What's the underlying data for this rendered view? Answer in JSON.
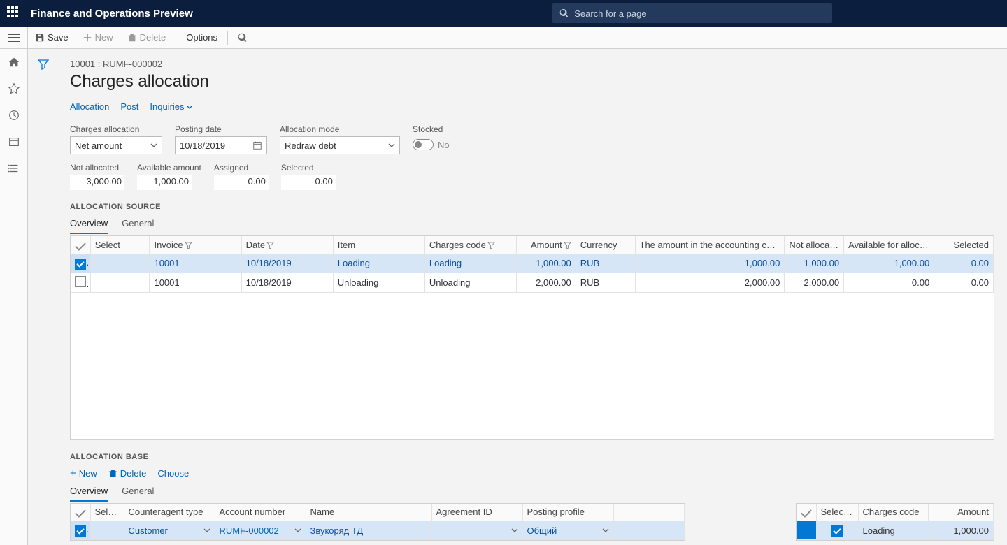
{
  "topbar": {
    "brand": "Finance and Operations Preview",
    "search_placeholder": "Search for a page"
  },
  "toolbar": {
    "save": "Save",
    "new": "New",
    "delete": "Delete",
    "options": "Options"
  },
  "breadcrumb": "10001 : RUMF-000002",
  "page_title": "Charges allocation",
  "actions": {
    "allocation": "Allocation",
    "post": "Post",
    "inquiries": "Inquiries"
  },
  "fields": {
    "charges_allocation": {
      "label": "Charges allocation",
      "value": "Net amount"
    },
    "posting_date": {
      "label": "Posting date",
      "value": "10/18/2019"
    },
    "allocation_mode": {
      "label": "Allocation mode",
      "value": "Redraw debt"
    },
    "stocked": {
      "label": "Stocked",
      "value": "No"
    }
  },
  "stats": {
    "not_allocated": {
      "label": "Not allocated",
      "value": "3,000.00"
    },
    "available": {
      "label": "Available amount",
      "value": "1,000.00"
    },
    "assigned": {
      "label": "Assigned",
      "value": "0.00"
    },
    "selected": {
      "label": "Selected",
      "value": "0.00"
    }
  },
  "section_source": "ALLOCATION SOURCE",
  "tabs_source": {
    "overview": "Overview",
    "general": "General"
  },
  "source_cols": {
    "select": "Select",
    "invoice": "Invoice",
    "date": "Date",
    "item": "Item",
    "charges_code": "Charges code",
    "amount": "Amount",
    "currency": "Currency",
    "acc_amount": "The amount in the accounting currency",
    "not_allocated": "Not allocated",
    "avail": "Available for allocation",
    "selected": "Selected"
  },
  "source_rows": [
    {
      "sel": true,
      "invoice": "10001",
      "date": "10/18/2019",
      "item": "Loading",
      "code": "Loading",
      "amount": "1,000.00",
      "currency": "RUB",
      "acc": "1,000.00",
      "na": "1,000.00",
      "avail": "1,000.00",
      "selv": "0.00"
    },
    {
      "sel": false,
      "invoice": "10001",
      "date": "10/18/2019",
      "item": "Unloading",
      "code": "Unloading",
      "amount": "2,000.00",
      "currency": "RUB",
      "acc": "2,000.00",
      "na": "2,000.00",
      "avail": "0.00",
      "selv": "0.00"
    }
  ],
  "section_base": "ALLOCATION BASE",
  "base_actions": {
    "new": "New",
    "delete": "Delete",
    "choose": "Choose"
  },
  "tabs_base": {
    "overview": "Overview",
    "general": "General"
  },
  "base_cols": {
    "select": "Select",
    "ctype": "Counteragent type",
    "account": "Account number",
    "name": "Name",
    "agreement": "Agreement ID",
    "profile": "Posting profile"
  },
  "base_rows": [
    {
      "sel": true,
      "ctype": "Customer",
      "account": "RUMF-000002",
      "name": "Звукоряд ТД",
      "agreement": "",
      "profile": "Общий"
    }
  ],
  "base2_cols": {
    "selected": "Selected",
    "code": "Charges code",
    "amount": "Amount"
  },
  "base2_rows": [
    {
      "sel": true,
      "code": "Loading",
      "amount": "1,000.00"
    }
  ]
}
